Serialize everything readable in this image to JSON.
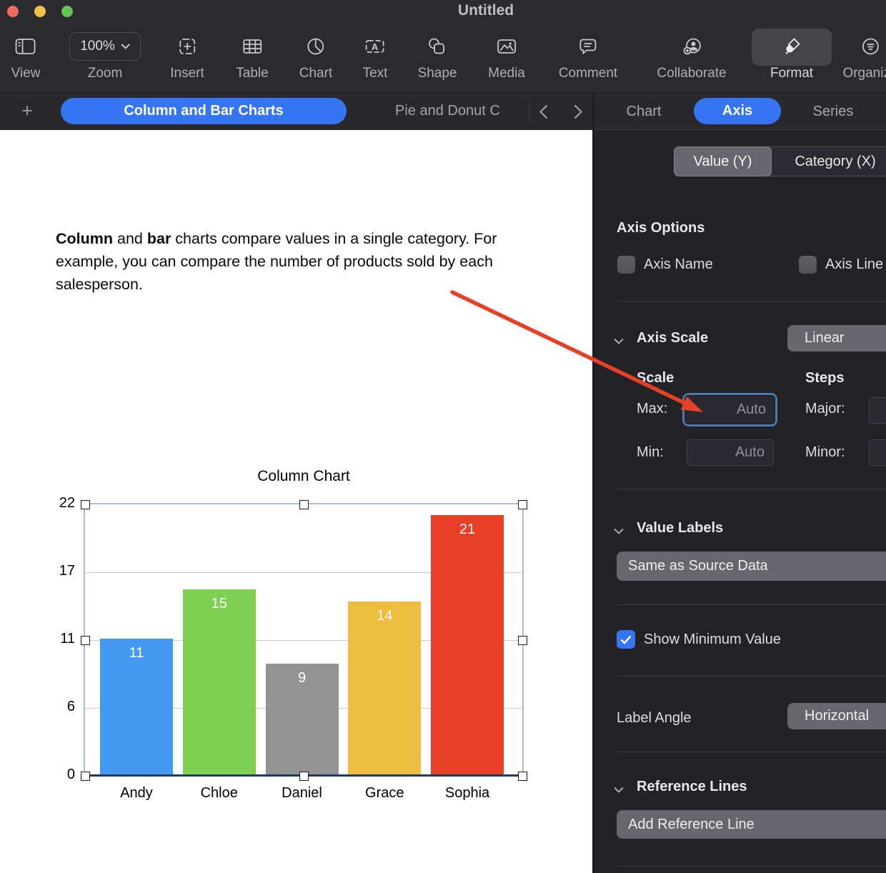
{
  "window": {
    "title": "Untitled"
  },
  "toolbar": {
    "zoom_value": "100%",
    "items": [
      {
        "label": "View",
        "icon": "view-sidebar-icon"
      },
      {
        "label": "Zoom",
        "icon": "zoom-dropdown"
      },
      {
        "label": "Insert",
        "icon": "insert-icon"
      },
      {
        "label": "Table",
        "icon": "table-icon"
      },
      {
        "label": "Chart",
        "icon": "chart-pie-icon"
      },
      {
        "label": "Text",
        "icon": "text-box-icon"
      },
      {
        "label": "Shape",
        "icon": "shape-icon"
      },
      {
        "label": "Media",
        "icon": "media-icon"
      },
      {
        "label": "Comment",
        "icon": "comment-icon"
      },
      {
        "label": "Collaborate",
        "icon": "collaborate-icon"
      },
      {
        "label": "Format",
        "icon": "format-brush-icon",
        "active": true
      },
      {
        "label": "Organize",
        "icon": "organize-icon"
      }
    ]
  },
  "tabbar": {
    "add_label": "+",
    "active_tab": "Column and Bar Charts",
    "inactive_tab": "Pie and Donut C",
    "chevron_left": "back",
    "chevron_right": "forward"
  },
  "sidebar": {
    "tabs": {
      "chart": "Chart",
      "axis": "Axis",
      "series": "Series"
    },
    "segments": {
      "value": "Value (Y)",
      "category": "Category (X)"
    },
    "axis_options": {
      "title": "Axis Options",
      "axis_name_label": "Axis Name",
      "axis_name_checked": false,
      "axis_line_label": "Axis Line",
      "axis_line_checked": false
    },
    "axis_scale": {
      "title": "Axis Scale",
      "dropdown": "Linear",
      "scale_label": "Scale",
      "steps_label": "Steps",
      "max_label": "Max:",
      "max_value": "Auto",
      "min_label": "Min:",
      "min_value": "Auto",
      "major_label": "Major:",
      "minor_label": "Minor:"
    },
    "value_labels": {
      "title": "Value Labels",
      "dropdown": "Same as Source Data"
    },
    "show_minimum": {
      "label": "Show Minimum Value",
      "checked": true
    },
    "label_angle": {
      "label": "Label Angle",
      "dropdown": "Horizontal"
    },
    "reference_lines": {
      "title": "Reference Lines",
      "button": "Add Reference Line"
    }
  },
  "document": {
    "paragraph_segments": [
      {
        "text": "Column",
        "bold": true
      },
      {
        "text": " and ",
        "bold": false
      },
      {
        "text": "bar",
        "bold": true
      },
      {
        "text": " charts compare values in a single category. For example, you can compare the number of products sold by each salesperson.",
        "bold": false
      }
    ]
  },
  "chart_data": {
    "type": "bar",
    "title": "Column Chart",
    "categories": [
      "Andy",
      "Chloe",
      "Daniel",
      "Grace",
      "Sophia"
    ],
    "values": [
      11,
      15,
      9,
      14,
      21
    ],
    "value_labels": [
      "11",
      "15",
      "9",
      "14",
      "21"
    ],
    "bar_colors": [
      "#459AF0",
      "#7ED053",
      "#939393",
      "#EDBD3F",
      "#E64026"
    ],
    "ytick_labels": [
      "0",
      "6",
      "11",
      "17",
      "22"
    ],
    "ylim": [
      0,
      22
    ],
    "xlabel": "",
    "ylabel": "",
    "grid": "horizontal",
    "legend": false,
    "selected": true
  },
  "colors": {
    "accent_blue": "#3574F2",
    "arrow_red": "#E64026",
    "focus_ring": "#4A7CAE",
    "selection_blue": "#A6BCF2",
    "axis_line_navy": "#1E3A66"
  }
}
